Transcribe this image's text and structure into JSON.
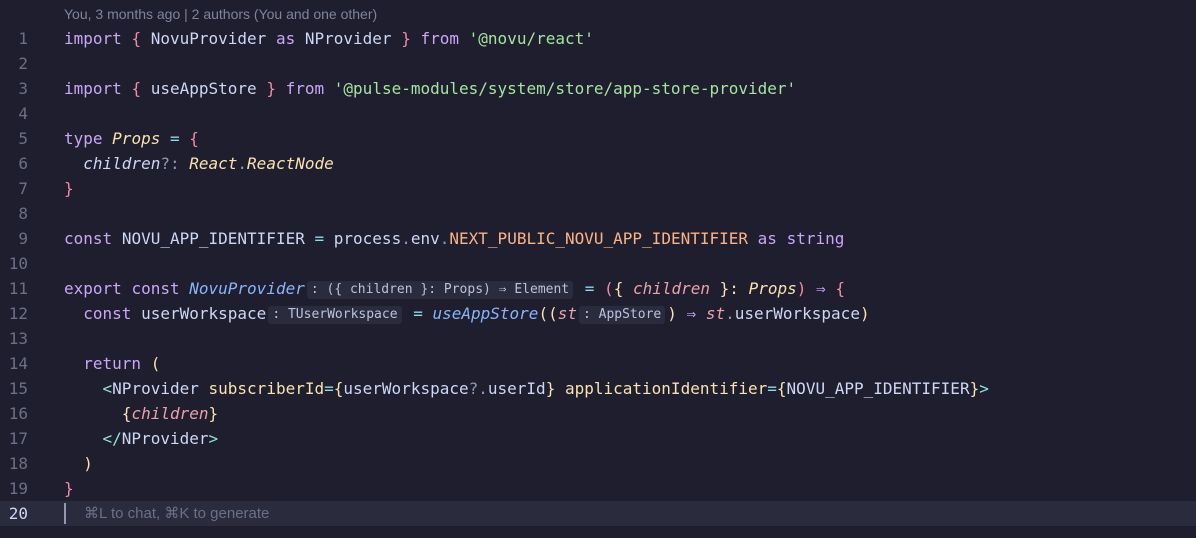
{
  "blame": {
    "text": "You, 3 months ago | 2 authors (You and one other)"
  },
  "line_numbers": [
    "1",
    "2",
    "3",
    "4",
    "5",
    "6",
    "7",
    "8",
    "9",
    "10",
    "11",
    "12",
    "13",
    "14",
    "15",
    "16",
    "17",
    "18",
    "19",
    "20"
  ],
  "l1": {
    "import": "import",
    "open": "{",
    "name": "NovuProvider",
    "as": "as",
    "alias": "NProvider",
    "close": "}",
    "from": "from",
    "module": "'@novu/react'"
  },
  "l3": {
    "import": "import",
    "open": "{",
    "name": "useAppStore",
    "close": "}",
    "from": "from",
    "module": "'@pulse-modules/system/store/app-store-provider'"
  },
  "l5": {
    "type": "type",
    "name": "Props",
    "eq": "=",
    "open": "{"
  },
  "l6": {
    "prop": "children",
    "opt": "?:",
    "tns": "React",
    "dot": ".",
    "ttype": "ReactNode"
  },
  "l7": {
    "close": "}"
  },
  "l9": {
    "const": "const",
    "name": "NOVU_APP_IDENTIFIER",
    "eq": "=",
    "obj": "process",
    "dot1": ".",
    "env": "env",
    "dot2": ".",
    "prop": "NEXT_PUBLIC_NOVU_APP_IDENTIFIER",
    "as": "as",
    "type": "string"
  },
  "l11": {
    "export": "export",
    "const": "const",
    "name": "NovuProvider",
    "hint": ": ({ children }: Props) ⇒ Element",
    "eq": "=",
    "open_paren": "(",
    "open_brace": "{",
    "param": "children",
    "close_brace": "}:",
    "type": "Props",
    "close_paren": ")",
    "arrow": "⇒",
    "body_open": "{"
  },
  "l12": {
    "const": "const",
    "name": "userWorkspace",
    "hint": ": TUserWorkspace",
    "eq": "=",
    "fn": "useAppStore",
    "open": "((",
    "param": "st",
    "hint2": ": AppStore",
    "close": ")",
    "arrow": "⇒",
    "obj": "st",
    "dot": ".",
    "prop": "userWorkspace",
    "end": ")"
  },
  "l14": {
    "return": "return",
    "open": "("
  },
  "l15": {
    "lt": "<",
    "tag": "NProvider",
    "attr1": "subscriberId",
    "eq1": "=",
    "o1": "{",
    "v1a": "userWorkspace",
    "v1b": "?.",
    "v1c": "userId",
    "c1": "}",
    "attr2": "applicationIdentifier",
    "eq2": "=",
    "o2": "{",
    "v2": "NOVU_APP_IDENTIFIER",
    "c2": "}",
    "gt": ">"
  },
  "l16": {
    "open": "{",
    "expr": "children",
    "close": "}"
  },
  "l17": {
    "lt": "</",
    "tag": "NProvider",
    "gt": ">"
  },
  "l18": {
    "close": ")"
  },
  "l19": {
    "close": "}"
  },
  "l20": {
    "placeholder": "⌘L to chat, ⌘K to generate"
  }
}
